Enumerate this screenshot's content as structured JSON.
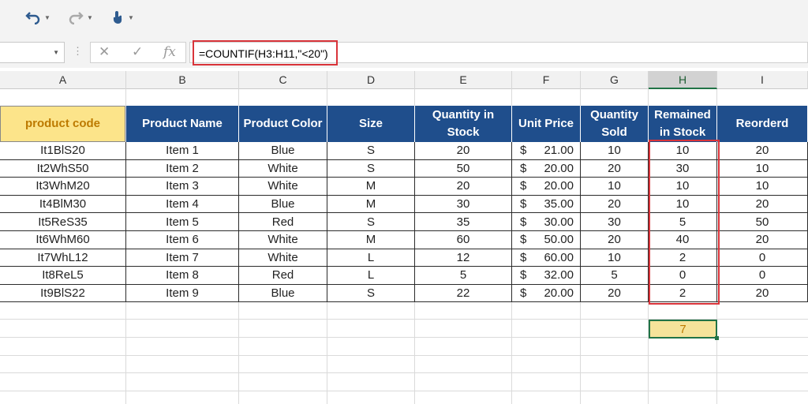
{
  "toolbar": {
    "undo_icon": "undo-icon",
    "redo_icon": "redo-icon",
    "touch_icon": "touch-mode-icon"
  },
  "formula_bar": {
    "name_box": "",
    "cancel_icon": "✕",
    "enter_icon": "✓",
    "fx_label": "fx",
    "formula": "=COUNTIF(H3:H11,\"<20\")"
  },
  "columns": [
    "A",
    "B",
    "C",
    "D",
    "E",
    "F",
    "G",
    "H",
    "I"
  ],
  "selected_column": "H",
  "table": {
    "headers": [
      "product code",
      "Product Name",
      "Product Color",
      "Size",
      "Quantity in Stock",
      "Unit Price",
      "Quantity Sold",
      "Remained in Stock",
      "Reorderd"
    ],
    "rows": [
      {
        "code": "It1BlS20",
        "name": "Item 1",
        "color": "Blue",
        "size": "S",
        "qty": "20",
        "cur": "$",
        "price": "21.00",
        "sold": "10",
        "remain": "10",
        "reorder": "20"
      },
      {
        "code": "It2WhS50",
        "name": "Item 2",
        "color": "White",
        "size": "S",
        "qty": "50",
        "cur": "$",
        "price": "20.00",
        "sold": "20",
        "remain": "30",
        "reorder": "10"
      },
      {
        "code": "It3WhM20",
        "name": "Item 3",
        "color": "White",
        "size": "M",
        "qty": "20",
        "cur": "$",
        "price": "20.00",
        "sold": "10",
        "remain": "10",
        "reorder": "10"
      },
      {
        "code": "It4BlM30",
        "name": "Item 4",
        "color": "Blue",
        "size": "M",
        "qty": "30",
        "cur": "$",
        "price": "35.00",
        "sold": "20",
        "remain": "10",
        "reorder": "20"
      },
      {
        "code": "It5ReS35",
        "name": "Item 5",
        "color": "Red",
        "size": "S",
        "qty": "35",
        "cur": "$",
        "price": "30.00",
        "sold": "30",
        "remain": "5",
        "reorder": "50"
      },
      {
        "code": "It6WhM60",
        "name": "Item 6",
        "color": "White",
        "size": "M",
        "qty": "60",
        "cur": "$",
        "price": "50.00",
        "sold": "20",
        "remain": "40",
        "reorder": "20"
      },
      {
        "code": "It7WhL12",
        "name": "Item 7",
        "color": "White",
        "size": "L",
        "qty": "12",
        "cur": "$",
        "price": "60.00",
        "sold": "10",
        "remain": "2",
        "reorder": "0"
      },
      {
        "code": "It8ReL5",
        "name": "Item 8",
        "color": "Red",
        "size": "L",
        "qty": "5",
        "cur": "$",
        "price": "32.00",
        "sold": "5",
        "remain": "0",
        "reorder": "0"
      },
      {
        "code": "It9BlS22",
        "name": "Item 9",
        "color": "Blue",
        "size": "S",
        "qty": "22",
        "cur": "$",
        "price": "20.00",
        "sold": "20",
        "remain": "2",
        "reorder": "20"
      }
    ]
  },
  "result_cell": "7",
  "colors": {
    "header_fill": "#1f4e8c",
    "first_header_fill": "#fce48a",
    "highlight_border": "#d9343a",
    "result_fill": "#f5e39a"
  }
}
